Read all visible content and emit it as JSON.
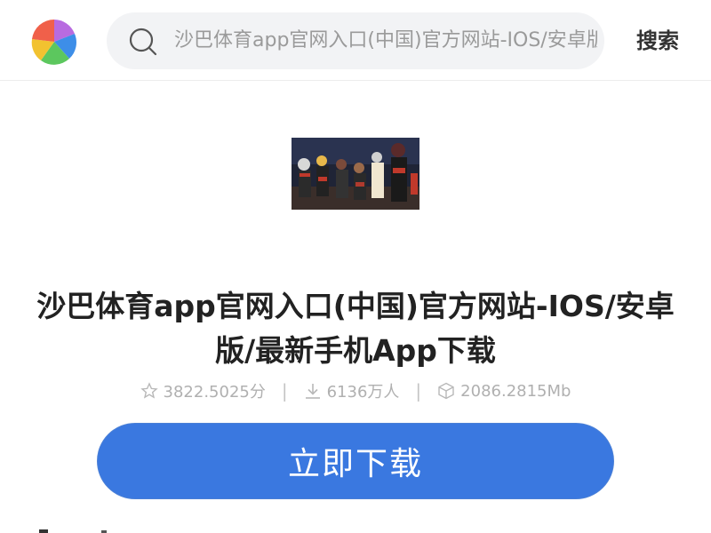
{
  "header": {
    "search_placeholder": "沙巴体育app官网入口(中国)官方网站-IOS/安卓版/最新手机App下载",
    "search_button": "搜索"
  },
  "app": {
    "title": "沙巴体育app官网入口(中国)官方网站-IOS/安卓版/最新手机App下载",
    "rating": "3822.5025分",
    "downloads": "6136万人",
    "size": "2086.2815Mb",
    "separator": "|",
    "download_button": "立即下载"
  },
  "colors": {
    "accent": "#3a78e0",
    "muted_text": "#b0b0b0"
  }
}
